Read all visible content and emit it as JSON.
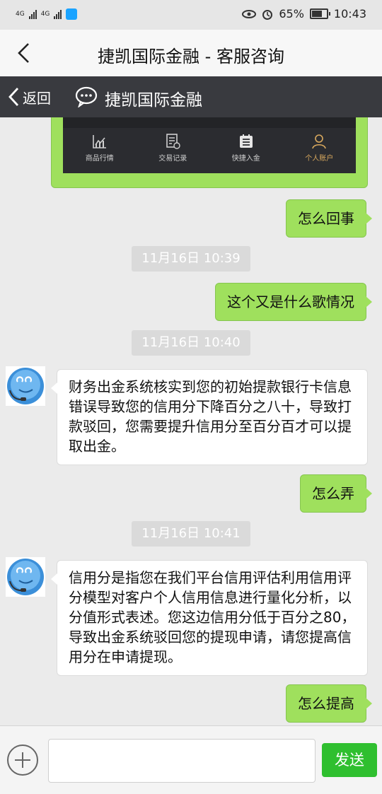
{
  "status_bar": {
    "signal_1": "4G",
    "signal_2": "4G",
    "battery": "65%",
    "time": "10:43"
  },
  "title_bar": {
    "title": "捷凯国际金融 - 客服咨询"
  },
  "nav_bar": {
    "back_label": "返回",
    "name": "捷凯国际金融"
  },
  "embedded_app_tabs": [
    {
      "label": "商品行情",
      "icon": "chart-icon"
    },
    {
      "label": "交易记录",
      "icon": "record-icon"
    },
    {
      "label": "快捷入金",
      "icon": "deposit-icon"
    },
    {
      "label": "个人账户",
      "icon": "person-icon"
    }
  ],
  "messages": {
    "m1": "怎么回事",
    "t1": "11月16日 10:39",
    "m2": "这个又是什么歌情况",
    "t2": "11月16日 10:40",
    "m3": "财务出金系统核实到您的初始提款银行卡信息错误导致您的信用分下降百分之八十，导致打款驳回，您需要提升信用分至百分百才可以提取出金。",
    "m4": "怎么弄",
    "t3": "11月16日 10:41",
    "m5": "信用分是指您在我们平台信用评估利用信用评分模型对客户个人信用信息进行量化分析，以分值形式表述。您这边信用分低于百分之80，导致出金系统驳回您的提现申请，请您提高信用分在申请提现。",
    "m6": "怎么提高"
  },
  "input_bar": {
    "send_label": "发送"
  },
  "colors": {
    "my_bubble": "#9fe05d",
    "send_button": "#2fbf2f",
    "nav_bar": "#393a3f",
    "active_tab": "#d9a95e"
  }
}
